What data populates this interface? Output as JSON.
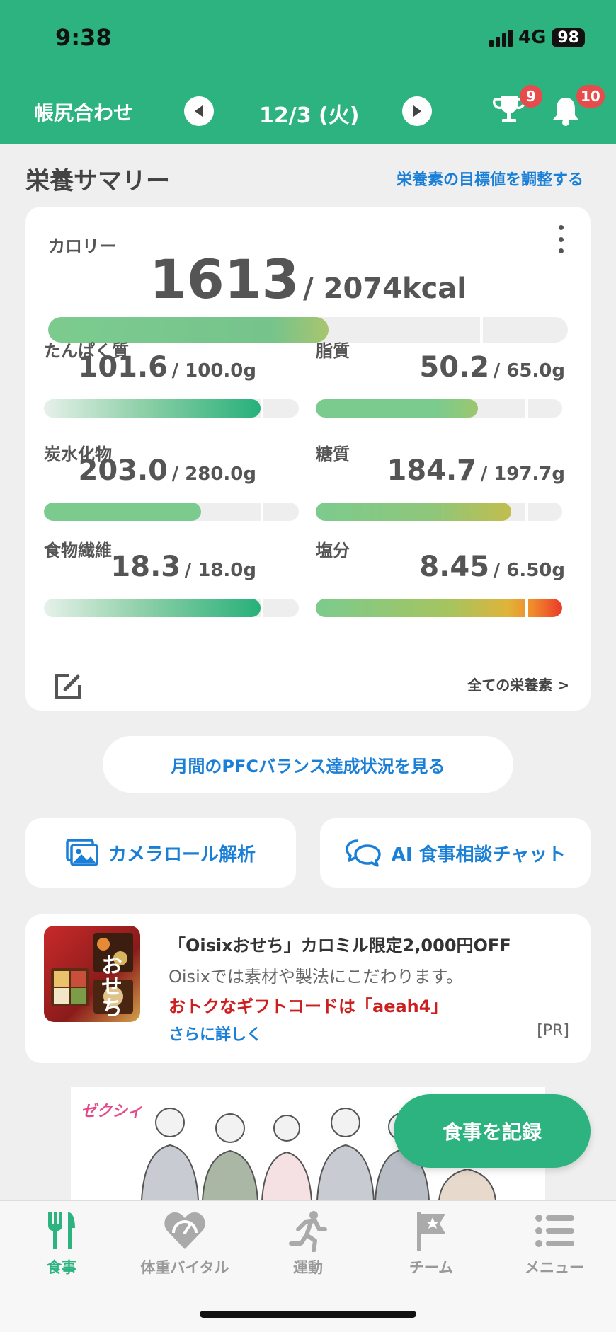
{
  "status": {
    "time": "9:38",
    "network": "4G",
    "battery": "98"
  },
  "header": {
    "reconcile_label": "帳尻合わせ",
    "date": "12/3 (火)",
    "trophy_badge": "9",
    "bell_badge": "10"
  },
  "summary": {
    "title": "栄養サマリー",
    "adjust_link": "栄養素の目標値を調整する",
    "calorie": {
      "label": "カロリー",
      "value": "1613",
      "target": "/ 2074kcal",
      "progress": 0.778
    },
    "nutrients": [
      {
        "name": "たんぱく質",
        "value": "101.6",
        "target": "/ 100.0g",
        "progress": 1.016
      },
      {
        "name": "脂質",
        "value": "50.2",
        "target": "/ 65.0g",
        "progress": 0.772
      },
      {
        "name": "炭水化物",
        "value": "203.0",
        "target": "/ 280.0g",
        "progress": 0.725
      },
      {
        "name": "糖質",
        "value": "184.7",
        "target": "/ 197.7g",
        "progress": 0.934
      },
      {
        "name": "食物繊維",
        "value": "18.3",
        "target": "/ 18.0g",
        "progress": 1.017
      },
      {
        "name": "塩分",
        "value": "8.45",
        "target": "/ 6.50g",
        "progress": 1.3
      }
    ],
    "all_nutrients_link": "全ての栄養素 >"
  },
  "pfc_button": "月間のPFCバランス達成状況を見る",
  "actions": {
    "camera_roll": "カメラロール解析",
    "ai_chat": "AI 食事相談チャット"
  },
  "ad": {
    "title": "「Oisixおせち」カロミル限定2,000円OFF",
    "desc": "Oisixでは素材や製法にこだわります。",
    "code": "おトクなギフトコードは「aeah4」",
    "more": "さらに詳しく",
    "pr": "[PR]",
    "thumb_text": "おせち"
  },
  "banner": {
    "logo": "ゼクシィ"
  },
  "fab_label": "食事を記録",
  "tabs": [
    {
      "label": "食事",
      "icon": "fork-knife-icon",
      "active": true
    },
    {
      "label": "体重バイタル",
      "icon": "heart-scale-icon",
      "active": false
    },
    {
      "label": "運動",
      "icon": "runner-icon",
      "active": false
    },
    {
      "label": "チーム",
      "icon": "flag-icon",
      "active": false
    },
    {
      "label": "メニュー",
      "icon": "menu-list-icon",
      "active": false
    }
  ],
  "colors": {
    "brand": "#2db380",
    "link": "#1a7fd6",
    "badge": "#e84b4b",
    "ad_red": "#cc1f1f"
  }
}
